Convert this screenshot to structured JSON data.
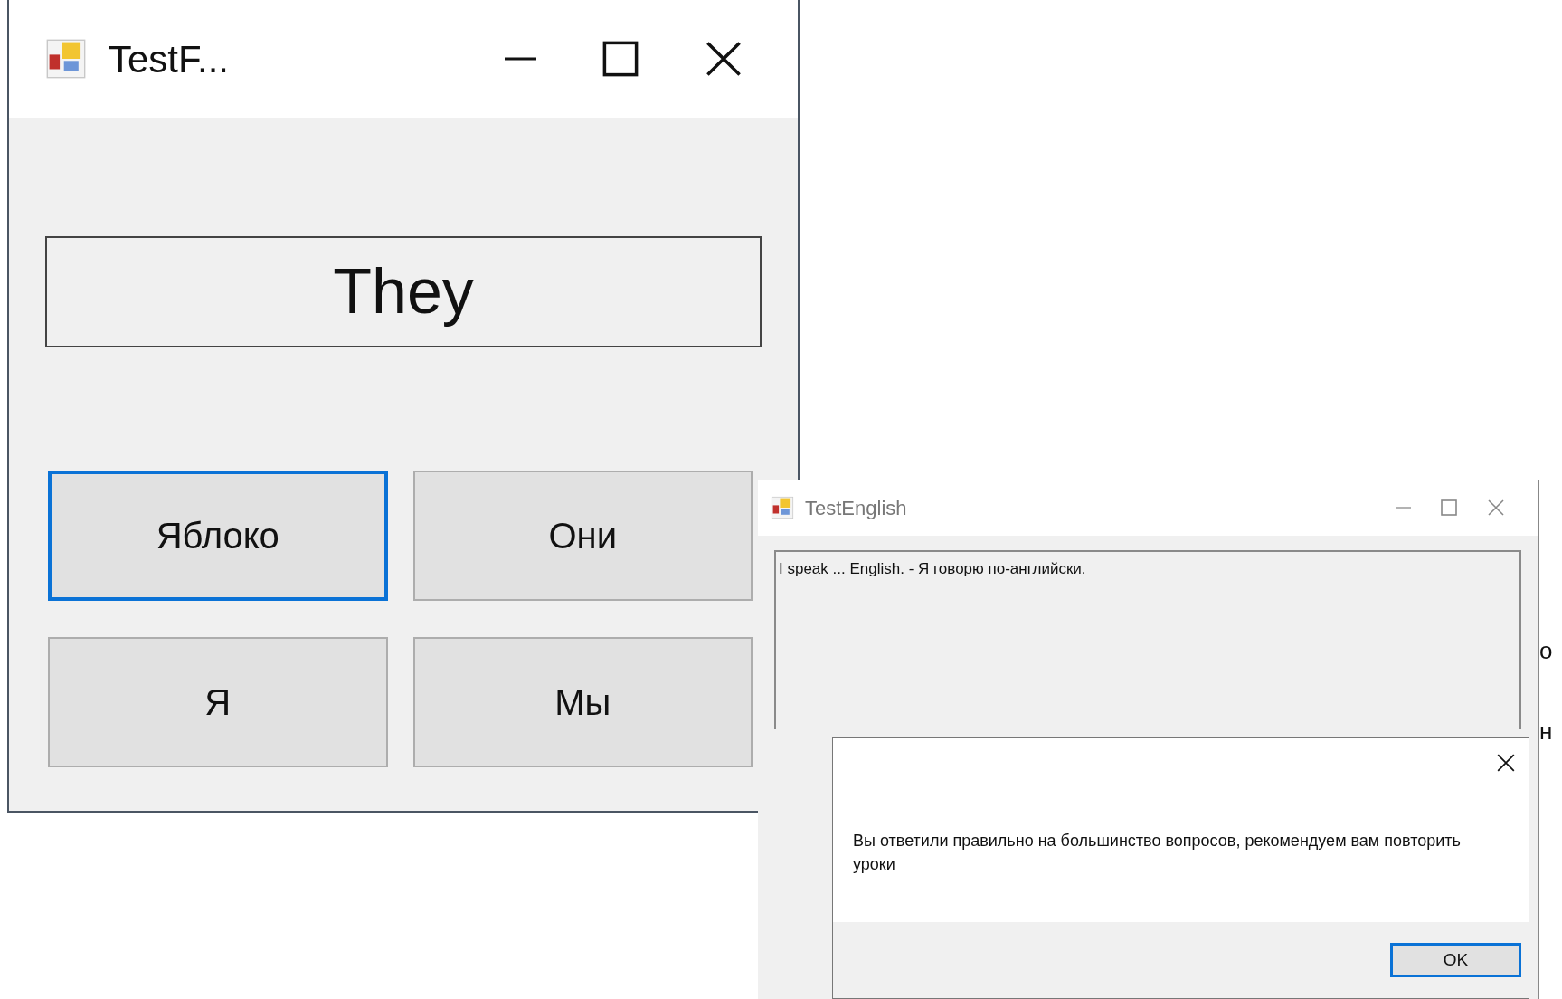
{
  "main_window": {
    "title": "TestF...",
    "word": "They",
    "answers": [
      {
        "label": "Яблоко",
        "focused": true
      },
      {
        "label": "Они",
        "focused": false
      },
      {
        "label": "Я",
        "focused": false
      },
      {
        "label": "Мы",
        "focused": false
      }
    ]
  },
  "second_window": {
    "title": "TestEnglish",
    "question": "I speak ... English. - Я говорю по-английски.",
    "background_fragments": [
      "о",
      "н"
    ]
  },
  "message_box": {
    "message": "Вы ответили правильно на большинство вопросов, рекомендуем вам повторить уроки",
    "buttons": [
      {
        "label": "OK",
        "focused": true
      }
    ]
  }
}
